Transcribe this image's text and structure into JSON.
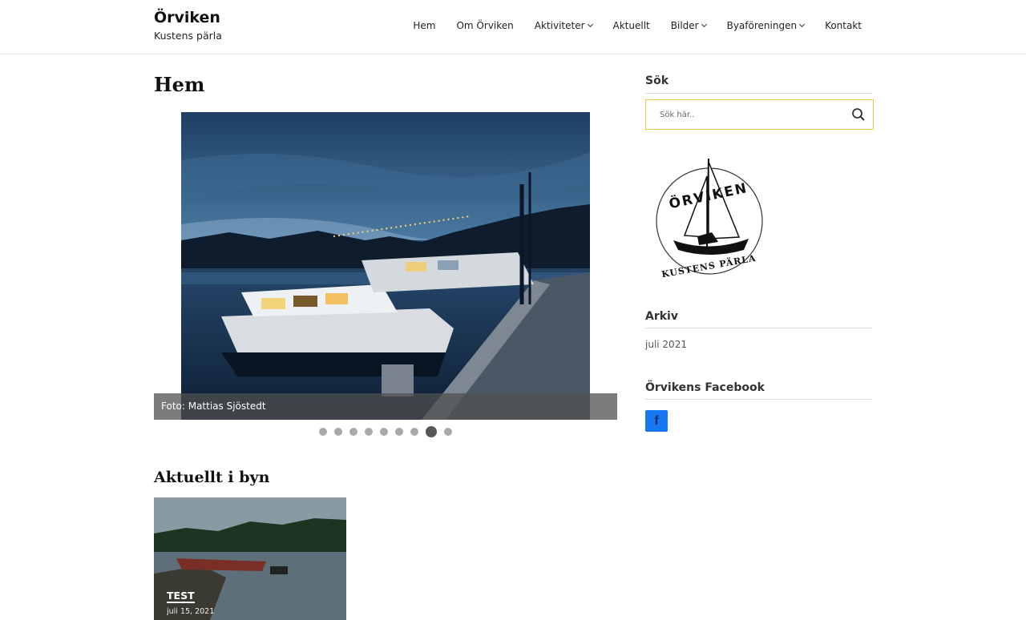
{
  "site": {
    "title": "Örviken",
    "tagline": "Kustens pärla"
  },
  "nav": {
    "items": [
      {
        "label": "Hem",
        "dropdown": false
      },
      {
        "label": "Om Örviken",
        "dropdown": false
      },
      {
        "label": "Aktiviteter",
        "dropdown": true
      },
      {
        "label": "Aktuellt",
        "dropdown": false
      },
      {
        "label": "Bilder",
        "dropdown": true
      },
      {
        "label": "Byaföreningen",
        "dropdown": true
      },
      {
        "label": "Kontakt",
        "dropdown": false
      }
    ]
  },
  "main": {
    "page_title": "Hem",
    "slider": {
      "caption": "Foto: Mattias Sjöstedt",
      "slide_count": 9,
      "active_index": 7
    },
    "news_title": "Aktuellt i byn",
    "posts": [
      {
        "title": "TEST",
        "date": "juli 15, 2021"
      }
    ]
  },
  "sidebar": {
    "search": {
      "title": "Sök",
      "placeholder": "Sök här.."
    },
    "logo": {
      "top_text": "ÖRVIKEN",
      "bottom_text": "KUSTENS PÄRLA"
    },
    "archive": {
      "title": "Arkiv",
      "items": [
        "juli 2021"
      ]
    },
    "facebook": {
      "title": "Örvikens Facebook",
      "icon_letter": "f"
    }
  },
  "colors": {
    "search_border": "#f2c744",
    "facebook_blue": "#1877f2",
    "caption_bg": "#505050"
  }
}
